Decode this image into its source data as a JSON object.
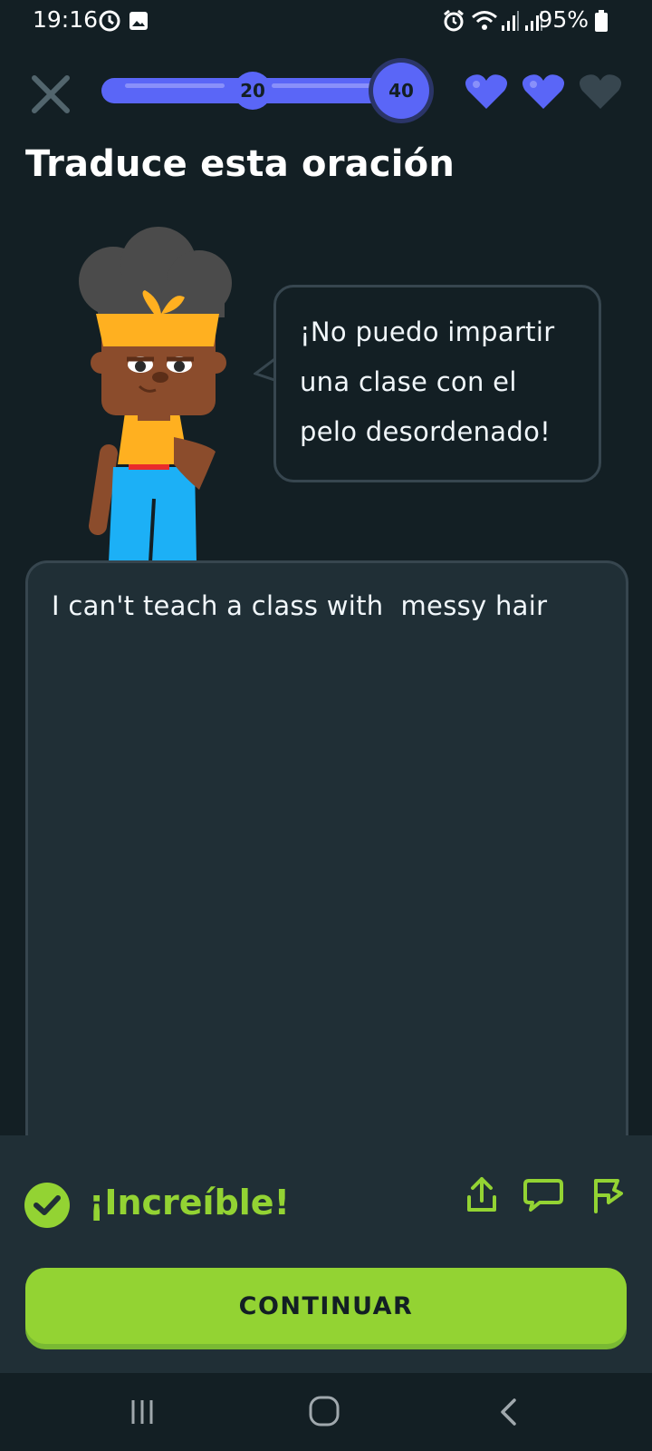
{
  "status_bar": {
    "time": "19:16",
    "battery": "95%",
    "left_icons": [
      "sync-icon",
      "image-icon"
    ],
    "right_icons": [
      "alarm-icon",
      "wifi-icon",
      "signal-icon",
      "signal-icon",
      "battery-icon"
    ]
  },
  "header": {
    "progress": {
      "current_badge": "20",
      "next_badge": "40"
    },
    "hearts": {
      "filled": 2,
      "total": 3
    }
  },
  "prompt": {
    "title": "Traduce esta oración",
    "sentence": "¡No puedo impartir\nuna clase con el\npelo desordenado!"
  },
  "answer": {
    "text": "I can't teach a class with  messy hair"
  },
  "feedback": {
    "title": "¡Increíble!",
    "icons": [
      "share-icon",
      "comment-icon",
      "report-flag-icon"
    ]
  },
  "continue_button": {
    "label": "CONTINUAR"
  },
  "nav_bar": {
    "icons": [
      "recent-apps-icon",
      "home-icon",
      "back-icon"
    ]
  },
  "colors": {
    "background": "#131f24",
    "panel": "#202f36",
    "border": "#37464f",
    "accent_blue": "#5a66f7",
    "success_green": "#93d333"
  }
}
